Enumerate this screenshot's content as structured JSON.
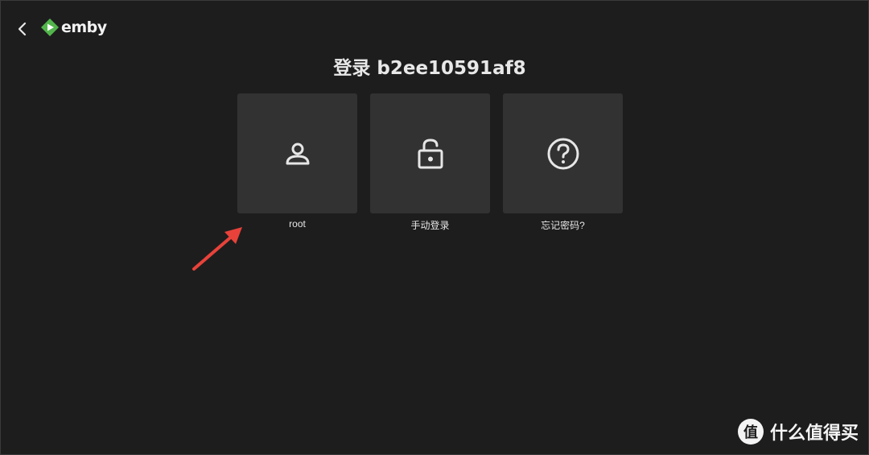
{
  "header": {
    "logo_text": "emby",
    "brand_color": "#52b54b"
  },
  "page": {
    "title": "登录 b2ee10591af8"
  },
  "cards": [
    {
      "label": "root",
      "icon": "user-icon"
    },
    {
      "label": "手动登录",
      "icon": "unlock-icon"
    },
    {
      "label": "忘记密码?",
      "icon": "help-icon"
    }
  ],
  "annotation": {
    "arrow_color": "#e8423a"
  },
  "watermark": {
    "badge": "值",
    "text": "什么值得买"
  }
}
